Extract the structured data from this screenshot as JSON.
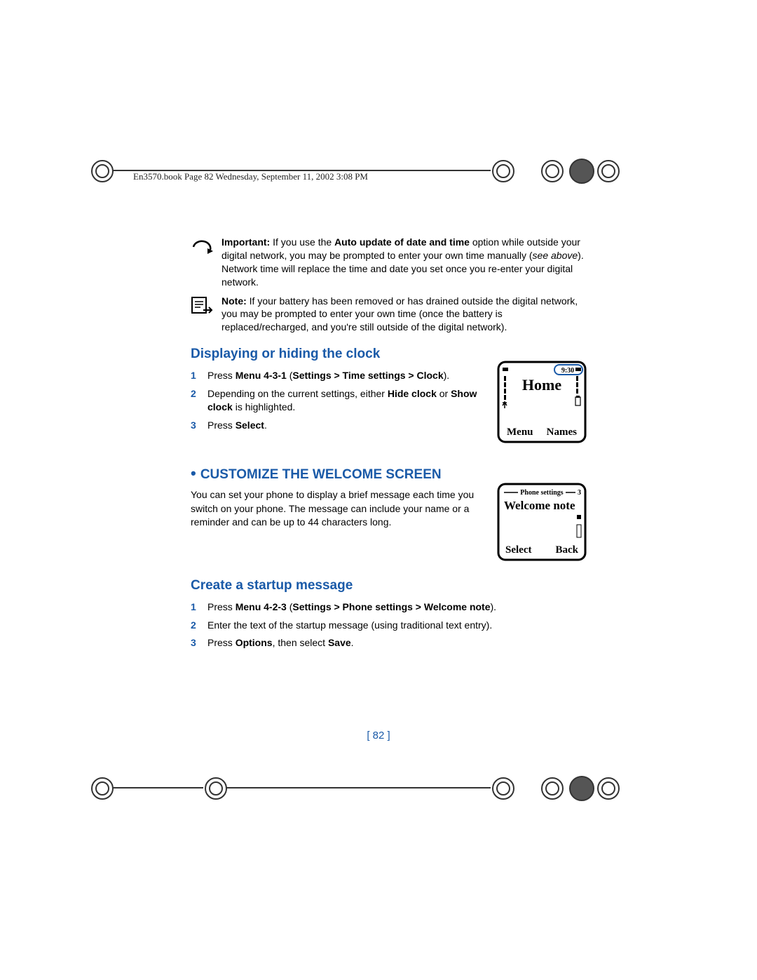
{
  "header": "En3570.book  Page 82  Wednesday, September 11, 2002  3:08 PM",
  "important": {
    "label": "Important:",
    "text1": " If you use the ",
    "bold1": "Auto update of date and time",
    "text2": " option while outside your digital network, you may be prompted to enter your own time manually (",
    "italic1": "see above",
    "text3": "). Network time will replace the time and date you set once you re-enter your digital network."
  },
  "note": {
    "label": "Note:",
    "text": "  If your battery has been removed or has drained outside the digital network, you may be prompted to enter your own time (once the battery is replaced/recharged, and you're still outside of the digital network)."
  },
  "section1": {
    "title": "Displaying or hiding the clock",
    "steps": [
      {
        "pre": "Press ",
        "b1": "Menu 4-3-1",
        "mid": " (",
        "b2": "Settings > Time settings > Clock",
        "post": ")."
      },
      {
        "pre": "Depending on the current settings, either ",
        "b1": "Hide clock",
        "mid": " or ",
        "b2": "Show clock",
        "post": " is highlighted."
      },
      {
        "pre": "Press ",
        "b1": "Select",
        "mid": "",
        "b2": "",
        "post": "."
      }
    ],
    "screen": {
      "time": "9:30",
      "title": "Home",
      "left": "Menu",
      "right": "Names"
    }
  },
  "section2": {
    "title": "Customize the welcome screen",
    "intro": "You can set your phone to display a brief message each time you switch on your phone. The message can include your name or a reminder and can be up to 44 characters long.",
    "screen": {
      "header": "Phone settings",
      "num": "3",
      "title": "Welcome note",
      "left": "Select",
      "right": "Back"
    }
  },
  "section3": {
    "title": "Create a startup message",
    "steps": [
      {
        "pre": "Press ",
        "b1": "Menu 4-2-3",
        "mid": " (",
        "b2": "Settings > Phone settings > Welcome note",
        "post": ")."
      },
      {
        "pre": "Enter the text of the startup message (using traditional text entry).",
        "b1": "",
        "mid": "",
        "b2": "",
        "post": ""
      },
      {
        "pre": "Press ",
        "b1": "Options",
        "mid": ", then select ",
        "b2": "Save",
        "post": "."
      }
    ]
  },
  "pageNum": "[ 82 ]"
}
